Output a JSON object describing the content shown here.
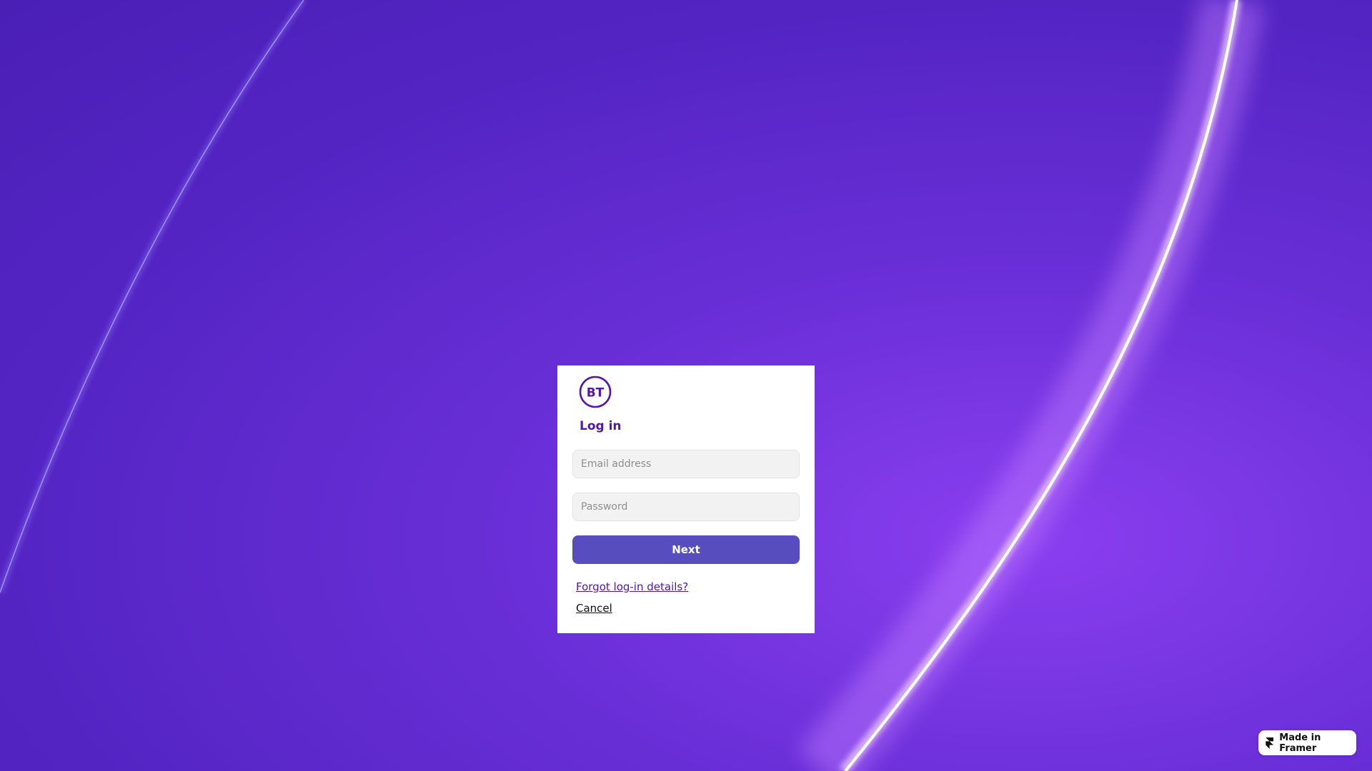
{
  "theme": {
    "background": "#5424c3",
    "brand_purple": "#5514b4",
    "button_color": "#574dbf"
  },
  "login": {
    "logo_text": "BT",
    "logo_icon": "bt-logo-icon",
    "title": "Log in",
    "email_placeholder": "Email address",
    "email_value": "",
    "password_placeholder": "Password",
    "password_value": "",
    "next_label": "Next",
    "forgot_label": "Forgot log-in details?",
    "cancel_label": "Cancel"
  },
  "badge": {
    "icon": "framer-icon",
    "label": "Made in Framer"
  }
}
